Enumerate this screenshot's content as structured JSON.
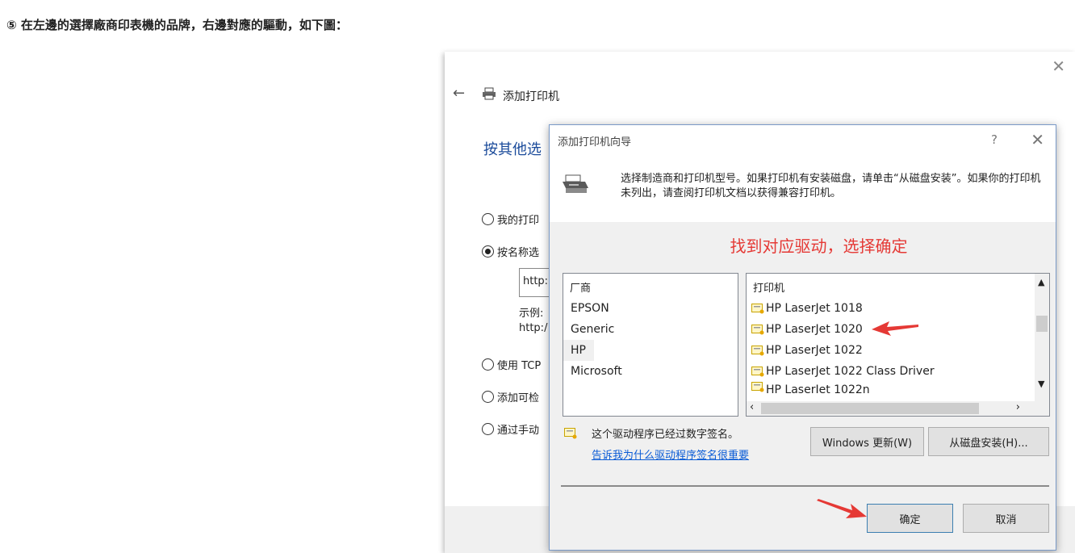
{
  "step_text": "⑤ 在左邊的選擇廠商印表機的品牌，右邊對應的驅動，如下圖：",
  "background_window": {
    "title": "添加打印机",
    "heading": "按其他选",
    "options": [
      {
        "label": "我的打印",
        "checked": false
      },
      {
        "label": "按名称选",
        "checked": true
      },
      {
        "label": "使用 TCP",
        "checked": false
      },
      {
        "label": "添加可检",
        "checked": false
      },
      {
        "label": "通过手动",
        "checked": false
      }
    ],
    "url_value": "http:",
    "example_label": "示例:",
    "example_value": "http:/"
  },
  "dialog": {
    "title": "添加打印机向导",
    "help_label": "?",
    "instruction": "选择制造商和打印机型号。如果打印机有安装磁盘，请单击“从磁盘安装”。如果你的打印机未列出，请查阅打印机文档以获得兼容打印机。",
    "annotation": "找到对应驱动，选择确定",
    "manufacturer_header": "厂商",
    "manufacturers": [
      "EPSON",
      "Generic",
      "HP",
      "Microsoft"
    ],
    "selected_manufacturer": "HP",
    "printer_header": "打印机",
    "printers": [
      "HP LaserJet 1018",
      "HP LaserJet 1020",
      "HP LaserJet 1022",
      "HP LaserJet 1022 Class Driver",
      "HP LaserJet 1022n"
    ],
    "selected_printer": "HP LaserJet 1020",
    "signature_text": "这个驱动程序已经过数字签名。",
    "signature_link": "告诉我为什么驱动程序签名很重要",
    "windows_update_label": "Windows 更新(W)",
    "have_disk_label": "从磁盘安装(H)...",
    "ok_label": "确定",
    "cancel_label": "取消"
  },
  "colors": {
    "annotation": "#e53935",
    "link": "#0b5cd6",
    "heading": "#1a4a9a"
  }
}
